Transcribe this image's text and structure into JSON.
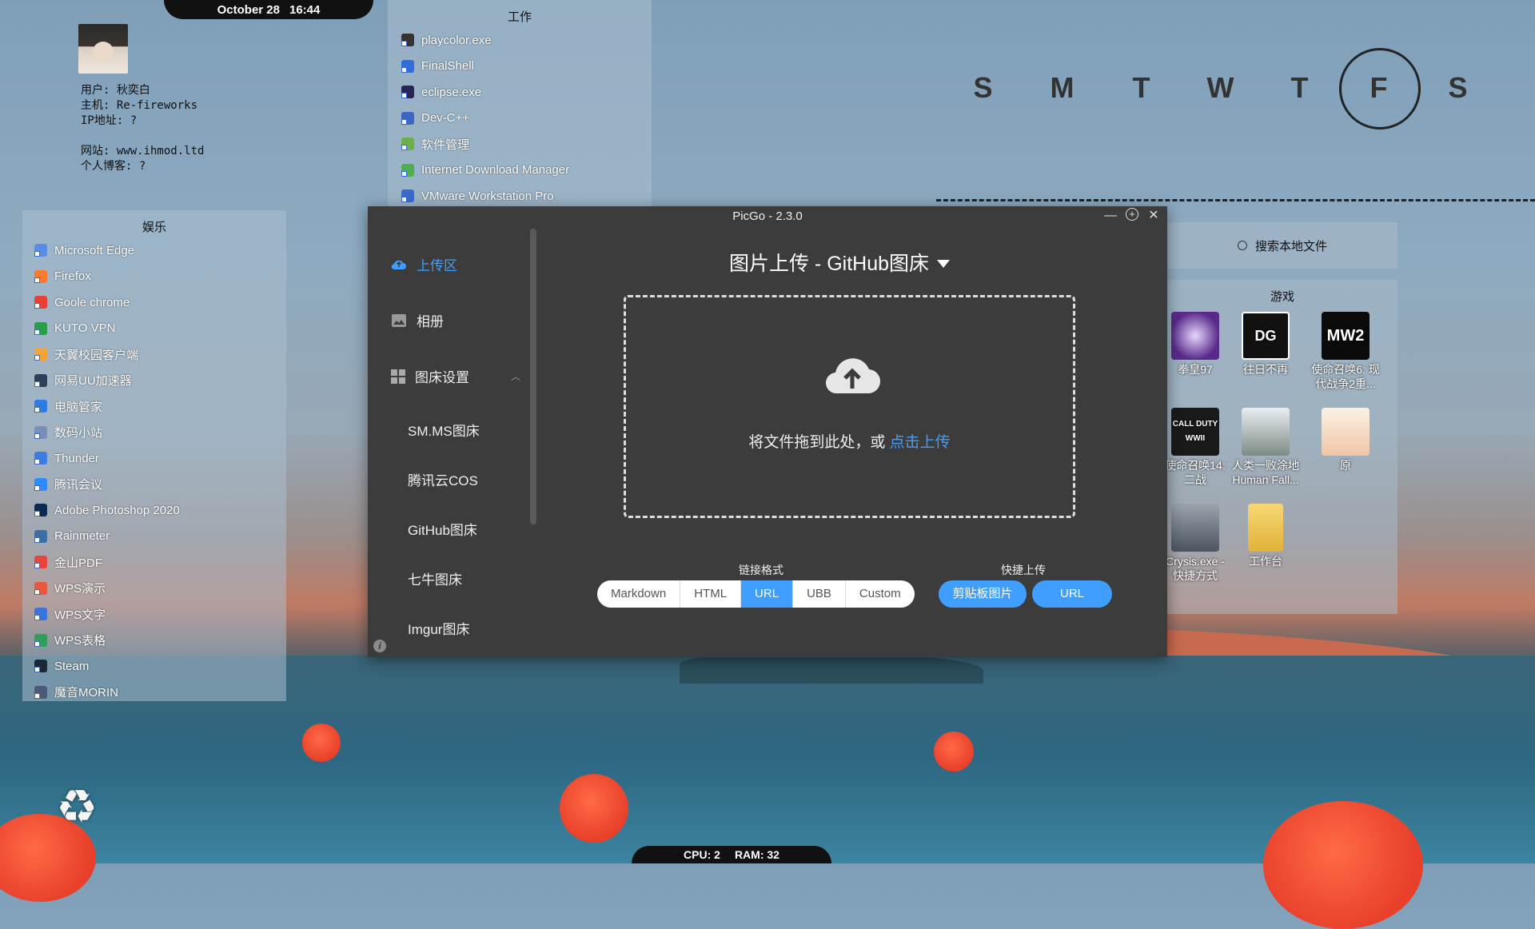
{
  "clock": {
    "date": "October 28",
    "time": "16:44"
  },
  "stats": {
    "cpu": "CPU: 2",
    "ram": "RAM: 32"
  },
  "user_info": {
    "user": "用户: 秋奕白",
    "host": "主机: Re-fireworks",
    "ip": "IP地址: ?",
    "website": "网站: www.ihmod.ltd",
    "blog": "个人博客: ?"
  },
  "panel_entertainment": {
    "title": "娱乐",
    "items": [
      "Microsoft Edge",
      "Firefox",
      "Goole chrome",
      "KUTO VPN",
      "天翼校园客户端",
      "网易UU加速器",
      "电脑管家",
      "数码小站",
      "Thunder",
      "腾讯会议",
      "Adobe Photoshop 2020",
      "Rainmeter",
      "金山PDF",
      "WPS演示",
      "WPS文字",
      "WPS表格",
      "Steam",
      "魔音MORIN"
    ]
  },
  "panel_work": {
    "title": "工作",
    "items": [
      "playcolor.exe",
      "FinalShell",
      "eclipse.exe",
      "Dev-C++",
      "软件管理",
      "Internet Download Manager",
      "VMware Workstation Pro"
    ]
  },
  "week": {
    "days": [
      "S",
      "M",
      "T",
      "W",
      "T",
      "F",
      "S"
    ],
    "today_index": 5
  },
  "search": {
    "placeholder": "搜索本地文件",
    "icon": "search-icon"
  },
  "games": {
    "title": "游戏",
    "items": [
      {
        "label": "拳皇97",
        "icon": "kof97-icon"
      },
      {
        "label": "往日不再",
        "icon": "days-gone-icon",
        "badge": "DG"
      },
      {
        "label": "使命召唤6: 现代战争2重...",
        "icon": "mw2-icon",
        "badge": "MW2"
      },
      {
        "label": "使命召唤14: 二战",
        "icon": "cod-ww2-icon",
        "badge": "CALL DUTY WWII"
      },
      {
        "label": "人类一败涂地 Human Fall...",
        "icon": "human-fall-flat-icon"
      },
      {
        "label": "原",
        "icon": "genshin-icon"
      },
      {
        "label": "Crysis.exe - 快捷方式",
        "icon": "crysis-icon"
      },
      {
        "label": "工作台",
        "icon": "folder-icon"
      }
    ]
  },
  "picgo": {
    "title": "PicGo - 2.3.0",
    "nav": {
      "upload": "上传区",
      "album": "相册",
      "settings": "图床设置",
      "sub": [
        "SM.MS图床",
        "腾讯云COS",
        "GitHub图床",
        "七牛图床",
        "Imgur图床"
      ]
    },
    "main_title": "图片上传 - GitHub图床",
    "drop_text": "将文件拖到此处，或 ",
    "drop_link": "点击上传",
    "format_label": "链接格式",
    "formats": [
      "Markdown",
      "HTML",
      "URL",
      "UBB",
      "Custom"
    ],
    "selected_format": "URL",
    "quick_label": "快捷上传",
    "quick_buttons": [
      "剪贴板图片",
      "URL"
    ],
    "accent": "#409eff"
  }
}
